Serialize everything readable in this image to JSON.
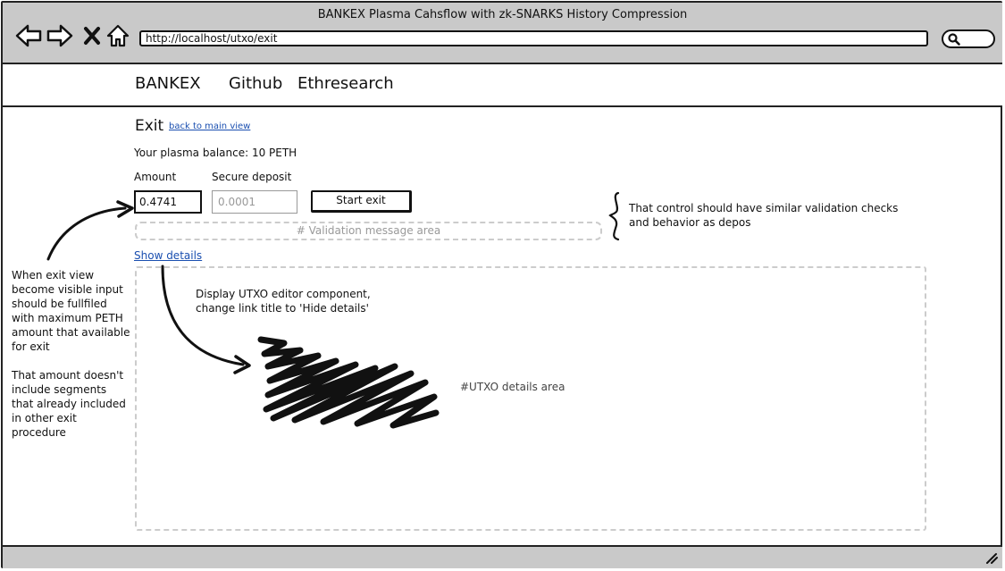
{
  "window": {
    "title": "BANKEX Plasma Cahsflow with zk-SNARKS History Compression",
    "url": "http://localhost/utxo/exit"
  },
  "header": {
    "links": [
      "BANKEX",
      "Github",
      "Ethresearch"
    ]
  },
  "exit": {
    "title": "Exit",
    "back_link": "back to main view",
    "balance_text": "Your plasma balance: 10 PETH",
    "amount_label": "Amount",
    "amount_value": "0.4741",
    "deposit_label": "Secure deposit",
    "deposit_placeholder": "0.0001",
    "start_button": "Start exit",
    "validation_placeholder": "# Validation message area",
    "show_details": "Show details",
    "details_area_label": "#UTXO details area"
  },
  "annotations": {
    "left_note_1": [
      "When exit view",
      "become visible input",
      "should be fullfiled",
      "with maximum PETH",
      "amount that available",
      "for exit"
    ],
    "left_note_2": [
      "That amount doesn't",
      "include segments",
      "that already included",
      "in other exit",
      "procedure"
    ],
    "brace_note": [
      "That  control should have similar validation checks",
      "and behavior as depos"
    ],
    "details_note": [
      "Display UTXO editor component,",
      "change link title to 'Hide details'"
    ]
  },
  "icons": [
    "back-arrow-icon",
    "forward-arrow-icon",
    "close-icon",
    "home-icon",
    "search-icon",
    "resize-grip-icon"
  ]
}
